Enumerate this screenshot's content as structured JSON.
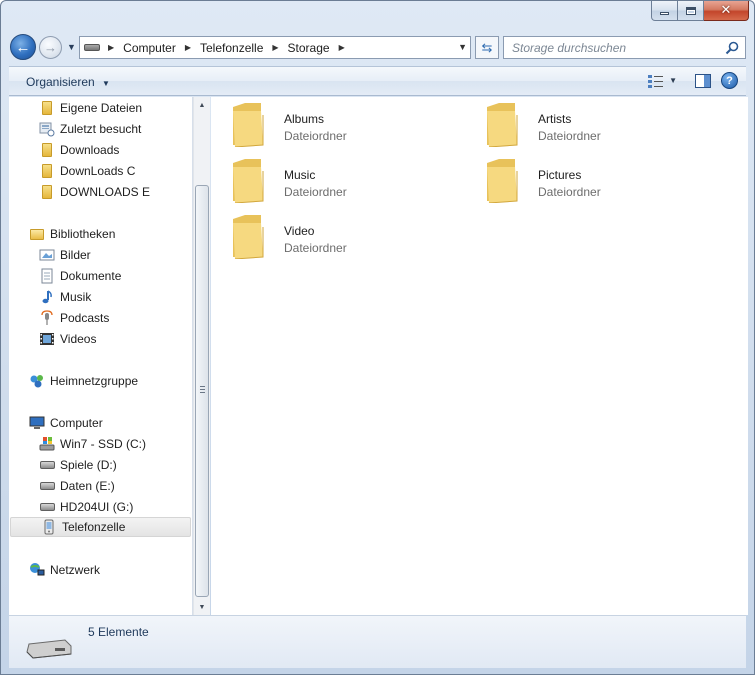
{
  "window": {
    "caption_buttons": [
      "minimize",
      "maximize",
      "close"
    ]
  },
  "navigation": {
    "breadcrumbs": [
      "Computer",
      "Telefonzelle",
      "Storage"
    ],
    "search_placeholder": "Storage durchsuchen"
  },
  "toolbar": {
    "organize_label": "Organisieren",
    "views_icon": "change-view-icon",
    "preview_pane_icon": "preview-pane-icon",
    "help_icon": "help-icon"
  },
  "sidebar": {
    "favorites": [
      {
        "label": "Eigene Dateien",
        "icon": "folder-icon"
      },
      {
        "label": "Zuletzt besucht",
        "icon": "recent-places-icon"
      },
      {
        "label": "Downloads",
        "icon": "folder-icon"
      },
      {
        "label": "DownLoads C",
        "icon": "folder-icon"
      },
      {
        "label": "DOWNLOADS E",
        "icon": "folder-icon"
      }
    ],
    "libraries_label": "Bibliotheken",
    "libraries": [
      {
        "label": "Bilder",
        "icon": "pictures-library-icon"
      },
      {
        "label": "Dokumente",
        "icon": "documents-library-icon"
      },
      {
        "label": "Musik",
        "icon": "music-library-icon"
      },
      {
        "label": "Podcasts",
        "icon": "podcasts-library-icon"
      },
      {
        "label": "Videos",
        "icon": "videos-library-icon"
      }
    ],
    "homegroup_label": "Heimnetzgruppe",
    "computer_label": "Computer",
    "drives": [
      {
        "label": "Win7 - SSD (C:)",
        "icon": "system-drive-icon"
      },
      {
        "label": "Spiele (D:)",
        "icon": "drive-icon"
      },
      {
        "label": "Daten (E:)",
        "icon": "drive-icon"
      },
      {
        "label": "HD204UI (G:)",
        "icon": "drive-icon"
      },
      {
        "label": "Telefonzelle",
        "icon": "phone-device-icon",
        "selected": true
      }
    ],
    "network_label": "Netzwerk"
  },
  "content": {
    "items": [
      {
        "name": "Albums",
        "type": "Dateiordner"
      },
      {
        "name": "Artists",
        "type": "Dateiordner"
      },
      {
        "name": "Music",
        "type": "Dateiordner"
      },
      {
        "name": "Pictures",
        "type": "Dateiordner"
      },
      {
        "name": "Video",
        "type": "Dateiordner"
      }
    ]
  },
  "details": {
    "count_label": "5 Elemente"
  },
  "colors": {
    "folder": "#f1cf62",
    "selection": "#e6e6e6",
    "chrome": "#cfdcec"
  }
}
